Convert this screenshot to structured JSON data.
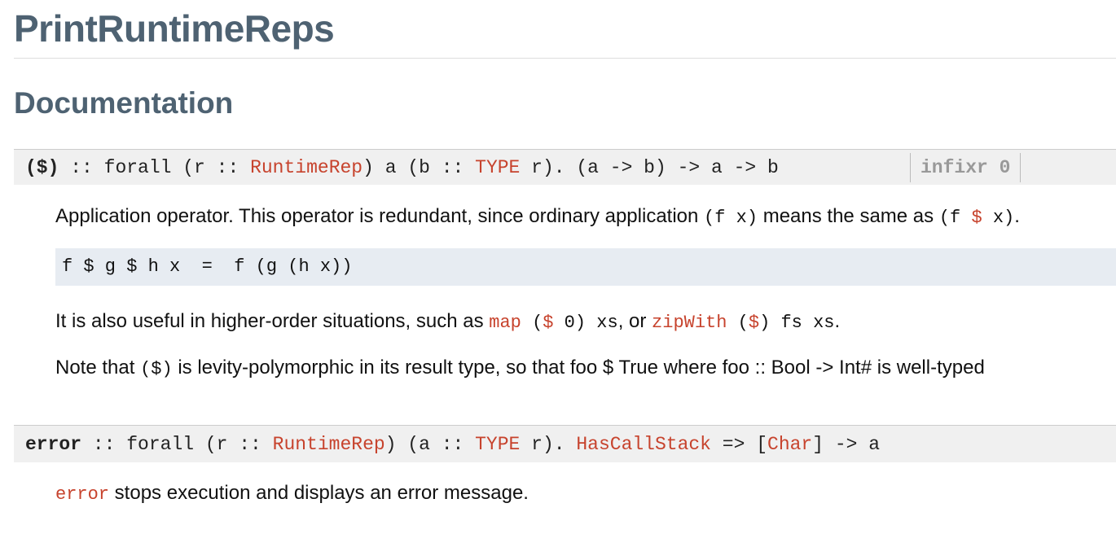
{
  "page": {
    "title": "PrintRuntimeReps",
    "section": "Documentation"
  },
  "decl1": {
    "name": "($)",
    "sep": " :: ",
    "p1": "forall (r :: ",
    "runtimerep": "RuntimeRep",
    "p2": ") a (b :: ",
    "type": "TYPE",
    "p3": " r). (a -> b) -> a -> b",
    "fixity": "infixr 0",
    "doc": {
      "p1_a": "Application operator. This operator is redundant, since ordinary application ",
      "p1_code1": "(f x)",
      "p1_b": " means the same as ",
      "p1_code2a": "(f ",
      "p1_code2op": "$",
      "p1_code2b": " x)",
      "p1_c": ".",
      "codeblock": "f $ g $ h x  =  f (g (h x))",
      "p2_a": "It is also useful in higher-order situations, such as ",
      "p2_map": "map",
      "p2_code1a": " (",
      "p2_code1op": "$",
      "p2_code1b": " 0) xs",
      "p2_b": ", or ",
      "p2_zipwith": "zipWith",
      "p2_code2a": " (",
      "p2_code2op": "$",
      "p2_code2b": ") fs xs",
      "p2_c": ".",
      "p3_a": "Note that ",
      "p3_code": "($)",
      "p3_b": " is levity-polymorphic in its result type, so that foo $ True where foo :: Bool -> Int# is well-typed"
    }
  },
  "decl2": {
    "name": "error",
    "sep": " :: ",
    "p1": "forall (r :: ",
    "runtimerep": "RuntimeRep",
    "p2": ") (a :: ",
    "type": "TYPE",
    "p3": " r). ",
    "hascallstack": "HasCallStack",
    "p4": " => [",
    "char": "Char",
    "p5": "] -> a",
    "doc": {
      "code": "error",
      "rest": " stops execution and displays an error message."
    }
  },
  "colors": {
    "heading": "#4e6272",
    "link": "#c7432d",
    "src_bg": "#f0f0f0",
    "code_bg": "#e7ecf2",
    "fixity": "#999999"
  }
}
